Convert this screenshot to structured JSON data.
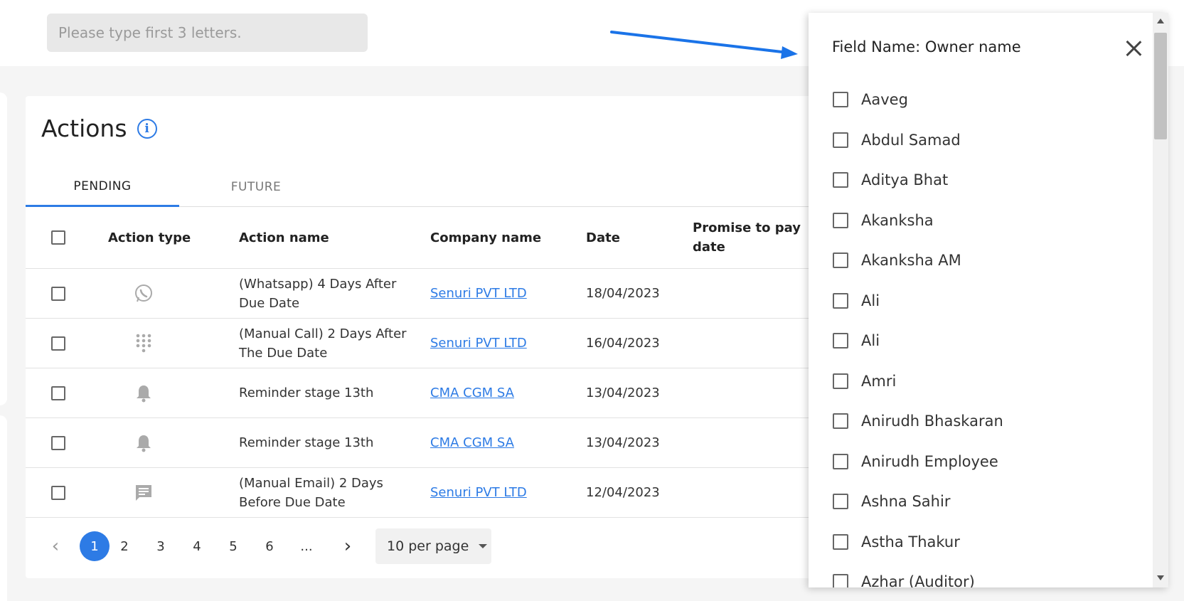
{
  "search": {
    "placeholder": "Please type first 3 letters."
  },
  "card": {
    "title": "Actions",
    "info_icon": "i"
  },
  "tabs": [
    {
      "label": "PENDING",
      "active": true
    },
    {
      "label": "FUTURE",
      "active": false
    }
  ],
  "table": {
    "headers": {
      "action_type": "Action type",
      "action_name": "Action name",
      "company_name": "Company name",
      "date": "Date",
      "promise": "Promise to pay date"
    },
    "rows": [
      {
        "icon": "whatsapp-icon",
        "name": "(Whatsapp) 4 Days After Due Date",
        "company": "Senuri PVT LTD",
        "date": "18/04/2023"
      },
      {
        "icon": "dialpad-icon",
        "name": "(Manual Call) 2 Days After The Due Date",
        "company": "Senuri PVT LTD",
        "date": "16/04/2023"
      },
      {
        "icon": "bell-icon",
        "name": "Reminder stage 13th",
        "company": "CMA CGM SA",
        "date": "13/04/2023"
      },
      {
        "icon": "bell-icon",
        "name": "Reminder stage 13th",
        "company": "CMA CGM SA",
        "date": "13/04/2023"
      },
      {
        "icon": "message-icon",
        "name": "(Manual Email) 2 Days Before Due Date",
        "company": "Senuri PVT LTD",
        "date": "12/04/2023"
      }
    ]
  },
  "pagination": {
    "prev": "‹",
    "next": "›",
    "pages": [
      "1",
      "2",
      "3",
      "4",
      "5",
      "6",
      "..."
    ],
    "current": "1",
    "per_page": "10 per page"
  },
  "panel": {
    "title": "Field Name: Owner name",
    "owners": [
      "Aaveg",
      "Abdul Samad",
      "Aditya Bhat",
      "Akanksha",
      "Akanksha AM",
      "Ali",
      "Ali",
      "Amri",
      "Anirudh Bhaskaran",
      "Anirudh Employee",
      "Ashna Sahir",
      "Astha Thakur",
      "Azhar (Auditor)"
    ]
  },
  "colors": {
    "accent": "#2d7be5",
    "arrow": "#1a73e8"
  }
}
